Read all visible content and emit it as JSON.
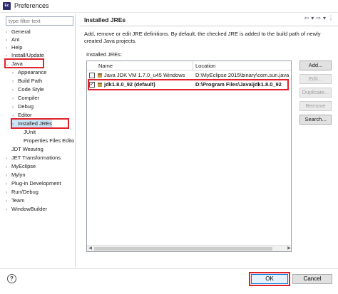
{
  "window": {
    "title": "Preferences",
    "app_icon_text": "Ec"
  },
  "filter": {
    "placeholder": "type filter text"
  },
  "tree": [
    {
      "label": "General",
      "arrow": "›",
      "level": 0
    },
    {
      "label": "Ant",
      "arrow": "›",
      "level": 0
    },
    {
      "label": "Help",
      "arrow": "›",
      "level": 0
    },
    {
      "label": "Install/Update",
      "arrow": "›",
      "level": 0
    },
    {
      "label": "Java",
      "arrow": "⌄",
      "level": 0
    },
    {
      "label": "Appearance",
      "arrow": "›",
      "level": 1
    },
    {
      "label": "Build Path",
      "arrow": "›",
      "level": 1
    },
    {
      "label": "Code Style",
      "arrow": "›",
      "level": 1
    },
    {
      "label": "Compiler",
      "arrow": "›",
      "level": 1
    },
    {
      "label": "Debug",
      "arrow": "›",
      "level": 1
    },
    {
      "label": "Editor",
      "arrow": "›",
      "level": 1
    },
    {
      "label": "Installed JREs",
      "arrow": "›",
      "level": 1
    },
    {
      "label": "JUnit",
      "arrow": "",
      "level": 1
    },
    {
      "label": "Properties Files Edito",
      "arrow": "",
      "level": 1
    },
    {
      "label": "JDT Weaving",
      "arrow": "",
      "level": 0
    },
    {
      "label": "JET Transformations",
      "arrow": "›",
      "level": 0
    },
    {
      "label": "MyEclipse",
      "arrow": "›",
      "level": 0
    },
    {
      "label": "Mylyn",
      "arrow": "›",
      "level": 0
    },
    {
      "label": "Plug-in Development",
      "arrow": "›",
      "level": 0
    },
    {
      "label": "Run/Debug",
      "arrow": "›",
      "level": 0
    },
    {
      "label": "Team",
      "arrow": "›",
      "level": 0
    },
    {
      "label": "WindowBuilder",
      "arrow": "›",
      "level": 0
    }
  ],
  "page": {
    "title": "Installed JREs",
    "description": "Add, remove or edit JRE definitions. By default, the checked JRE is added to the build path of newly created Java projects.",
    "jre_label": "Installed JREs:",
    "nav_back": "⇦",
    "nav_back_menu": "▾",
    "nav_fwd": "⇨",
    "nav_fwd_menu": "▾",
    "nav_more": "⋮"
  },
  "table": {
    "columns": [
      "Name",
      "Location"
    ],
    "rows": [
      {
        "checked": "",
        "name": "Java JDK VM 1.7.0_u45 Windows",
        "location": "D:\\MyEclipse 2015\\binary\\com.sun.java"
      },
      {
        "checked": "✓",
        "name": "jdk1.8.0_92 (default)",
        "location": "D:\\Program Files\\Java\\jdk1.8.0_92"
      }
    ]
  },
  "buttons": {
    "add": "Add...",
    "edit": "Edit...",
    "duplicate": "Duplicate...",
    "remove": "Remove",
    "search": "Search..."
  },
  "footer": {
    "help": "?",
    "ok": "OK",
    "cancel": "Cancel"
  },
  "colors": {
    "highlight_red": "#e0222a",
    "selection": "#cce4f7",
    "ok_border": "#0078d7"
  }
}
